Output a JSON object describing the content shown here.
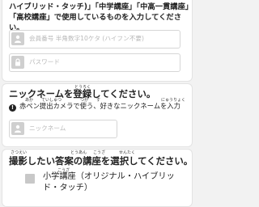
{
  "login": {
    "intro": "ハイブリッド・タッチ)」「中学講座」「中高一貫講座」「高校講座」で使用しているものを入力してください。",
    "member_placeholder": "会員番号 半角数字10ケタ (ハイフン不要)",
    "password_placeholder": "パスワード",
    "icons": {
      "member": "user-icon",
      "password": "lock-icon"
    }
  },
  "nickname": {
    "title": "ニックネームを登録してください。",
    "title_ruby": "とうろく",
    "notice": "赤ペン提出カメラで使う、好きなニックネームを入力",
    "notice_ruby": [
      "あか",
      "ていしゅつ",
      "つか",
      "す",
      "にゅうりょく"
    ],
    "placeholder": "ニックネーム",
    "icons": {
      "notice": "alert-icon",
      "field": "user-icon"
    }
  },
  "course": {
    "title": "撮影したい答案の講座を選択してください。",
    "title_ruby": [
      "さつえい",
      "とうあん",
      "こうざ",
      "せんたく"
    ],
    "option_label": "小学講座（オリジナル・ハイブリッド・タッチ）",
    "option_line1": "小学講座（オリジナル・ハイブリッ",
    "option_line2": "ド・タッチ）",
    "option_ruby": "こうざ",
    "checked": false
  }
}
